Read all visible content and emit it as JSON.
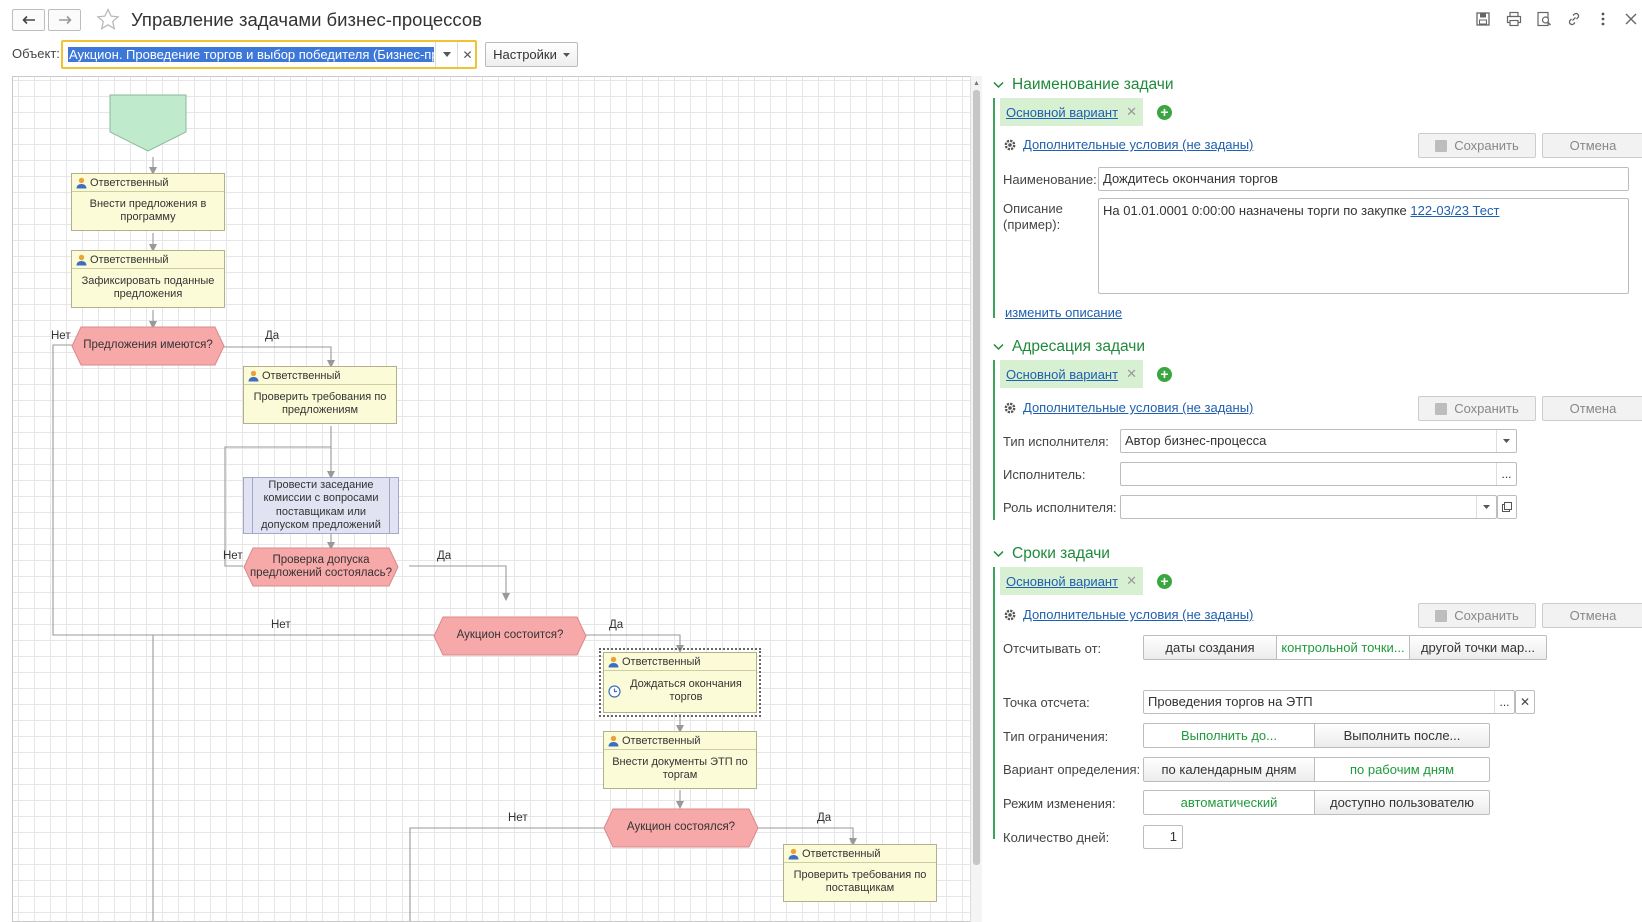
{
  "window": {
    "title": "Управление задачами бизнес-процессов"
  },
  "object": {
    "label": "Объект:",
    "value": "Аукцион. Проведение торгов и выбор победителя (Бизнес-процесс)",
    "settings_label": "Настройки"
  },
  "diagram": {
    "responsible": "Ответственный",
    "tasks": [
      {
        "text": "Внести предложения в программу"
      },
      {
        "text": "Зафиксировать поданные предложения"
      },
      {
        "text": "Проверить требования по предложениям"
      },
      {
        "text": "Дождаться окончания торгов"
      },
      {
        "text": "Внести документы ЭТП по торгам"
      },
      {
        "text": "Проверить требования по поставщикам"
      }
    ],
    "process": "Провести заседание комиссии с вопросами поставщикам или допуском предложений",
    "conditions": [
      {
        "text": "Предложения имеются?"
      },
      {
        "text": "Проверка допуска предложений состоялась?"
      },
      {
        "text": "Аукцион состоится?"
      },
      {
        "text": "Аукцион состоялся?"
      }
    ],
    "edge_labels": {
      "no": "Нет",
      "yes": "Да"
    }
  },
  "task_name": {
    "title": "Наименование задачи",
    "variant": "Основной вариант",
    "conditions_link": "Дополнительные условия (не заданы)",
    "save_label": "Сохранить",
    "cancel_label": "Отмена",
    "name_label": "Наименование:",
    "name_value": "Дождитесь окончания торгов",
    "desc_label_1": "Описание",
    "desc_label_2": "(пример):",
    "desc_text": "На 01.01.0001 0:00:00 назначены торги по закупке ",
    "desc_link": "122-03/23 Тест",
    "change_desc_link": "изменить описание"
  },
  "addressing": {
    "title": "Адресация задачи",
    "variant": "Основной вариант",
    "conditions_link": "Дополнительные условия (не заданы)",
    "save_label": "Сохранить",
    "cancel_label": "Отмена",
    "performer_type_label": "Тип исполнителя:",
    "performer_type_value": "Автор бизнес-процесса",
    "performer_label": "Исполнитель:",
    "performer_value": "",
    "role_label": "Роль исполнителя:",
    "role_value": ""
  },
  "deadlines": {
    "title": "Сроки задачи",
    "variant": "Основной вариант",
    "conditions_link": "Дополнительные условия (не заданы)",
    "save_label": "Сохранить",
    "cancel_label": "Отмена",
    "count_from_label": "Отсчитывать от:",
    "count_from_options": [
      "даты создания",
      "контрольной точки...",
      "другой точки мар..."
    ],
    "count_from_selected": 1,
    "ref_point_label": "Точка отсчета:",
    "ref_point_value": "Проведения торгов на ЭТП",
    "limit_type_label": "Тип ограничения:",
    "limit_type_options": [
      "Выполнить до...",
      "Выполнить после..."
    ],
    "limit_type_selected": 0,
    "def_variant_label": "Вариант определения:",
    "def_variant_options": [
      "по календарным дням",
      "по рабочим дням"
    ],
    "def_variant_selected": 1,
    "change_mode_label": "Режим изменения:",
    "change_mode_options": [
      "автоматический",
      "доступно пользователю"
    ],
    "change_mode_selected": 0,
    "days_label": "Количество дней:",
    "days_value": "1"
  },
  "colors": {
    "accent_green": "#1f8a3b",
    "variant_bg": "#d7f0d2",
    "condition_fill": "#f7a8a8",
    "task_fill": "#fcfbd8",
    "start_fill": "#bfeacc",
    "focus_yellow": "#f1c232"
  }
}
